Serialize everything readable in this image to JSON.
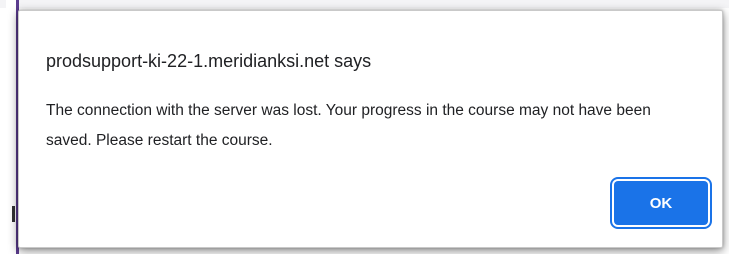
{
  "dialog": {
    "title": "prodsupport-ki-22-1.meridianksi.net says",
    "message": "The connection with the server was lost. Your progress in the course may not have been saved. Please restart the course.",
    "ok_label": "OK"
  },
  "colors": {
    "button_bg": "#1a73e8",
    "button_text": "#ffffff",
    "text": "#202124",
    "background_accent": "#5b3c8f"
  }
}
